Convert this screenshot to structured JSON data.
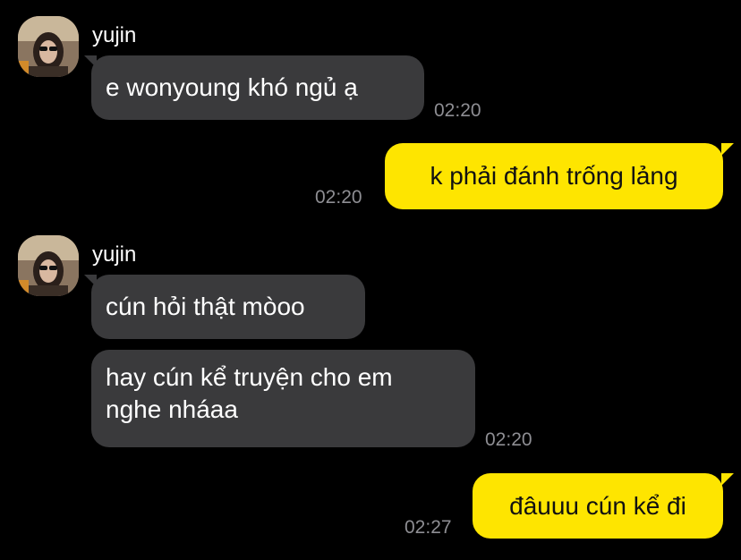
{
  "messages": [
    {
      "sender": "yujin",
      "direction": "incoming",
      "text": "e wonyoung khó ngủ ạ",
      "time": "02:20"
    },
    {
      "direction": "outgoing",
      "text": "k phải đánh trống lảng",
      "time": "02:20"
    },
    {
      "sender": "yujin",
      "direction": "incoming",
      "text": "cún hỏi thật mòoo"
    },
    {
      "direction": "incoming",
      "text_lines": [
        "hay cún kể truyện cho em",
        "nghe nháaa"
      ],
      "time": "02:20"
    },
    {
      "direction": "outgoing",
      "text": "đâuuu cún kể đi",
      "time": "02:27"
    }
  ],
  "colors": {
    "background": "#000000",
    "incoming_bubble": "#3a3a3c",
    "outgoing_bubble": "#fee500",
    "timestamp": "#8e8e93"
  }
}
